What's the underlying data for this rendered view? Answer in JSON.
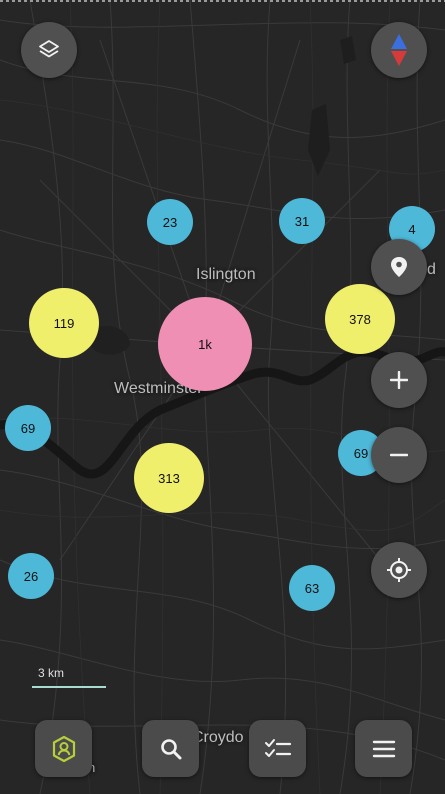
{
  "map": {
    "place_labels": {
      "islington": "Islington",
      "westminster": "Westminster",
      "croydon": "Croydo",
      "right_edge": "d",
      "bottom_left": "n"
    },
    "scale": {
      "label": "3 km"
    }
  },
  "clusters": [
    {
      "id": "a",
      "label": "23",
      "color": "#4eb8d9"
    },
    {
      "id": "b",
      "label": "31",
      "color": "#4eb8d9"
    },
    {
      "id": "c",
      "label": "4",
      "color": "#4eb8d9"
    },
    {
      "id": "d",
      "label": "119",
      "color": "#f0ef6c"
    },
    {
      "id": "e",
      "label": "1k",
      "color": "#ee8fb3"
    },
    {
      "id": "f",
      "label": "378",
      "color": "#f0ef6c"
    },
    {
      "id": "g",
      "label": "69",
      "color": "#4eb8d9"
    },
    {
      "id": "h",
      "label": "69",
      "color": "#4eb8d9"
    },
    {
      "id": "i",
      "label": "313",
      "color": "#f0ef6c"
    },
    {
      "id": "j",
      "label": "26",
      "color": "#4eb8d9"
    },
    {
      "id": "k",
      "label": "63",
      "color": "#4eb8d9"
    }
  ],
  "controls": {
    "layers_icon": "layers-icon",
    "compass_icon": "compass-icon",
    "poi_icon": "map-pin-icon",
    "zoom_in_icon": "plus-icon",
    "zoom_out_icon": "minus-icon",
    "locate_icon": "crosshair-icon"
  },
  "bottom_bar": {
    "items": [
      "profile-icon",
      "search-icon",
      "checklist-icon",
      "menu-icon"
    ]
  },
  "colors": {
    "background": "#262626",
    "blue": "#4eb8d9",
    "yellow": "#f0ef6c",
    "pink": "#ee8fb3",
    "river": "#171717",
    "profile_accent": "#b8cf3c"
  }
}
